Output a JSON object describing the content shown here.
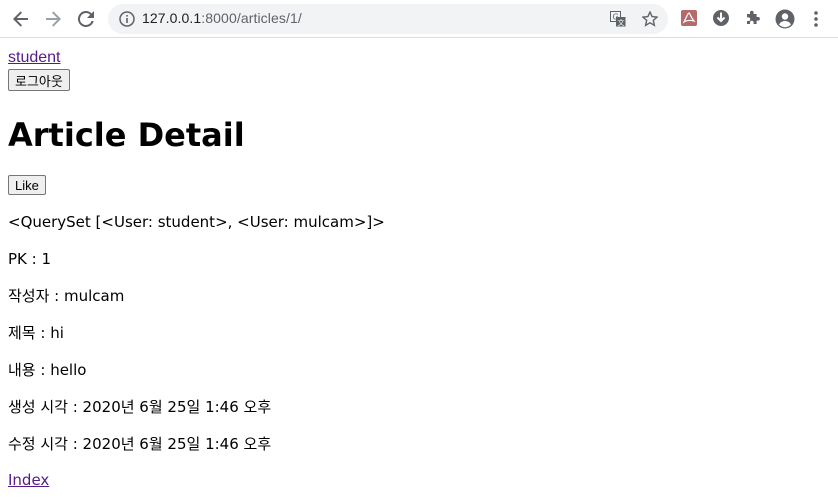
{
  "browser": {
    "url_host": "127.0.0.1",
    "url_path": ":8000/articles/1/"
  },
  "header": {
    "user_link": "student",
    "logout_label": "로그아웃"
  },
  "article": {
    "title": "Article Detail",
    "like_label": "Like",
    "queryset": "<QuerySet [<User: student>, <User: mulcam>]>",
    "pk": "PK : 1",
    "author": "작성자 : mulcam",
    "subject": "제목 : hi",
    "content": "내용 : hello",
    "created": "생성 시각 : 2020년 6월 25일 1:46 오후",
    "updated": "수정 시각 : 2020년 6월 25일 1:46 오후",
    "index_link": "Index"
  },
  "colors": {
    "link": "#551a8b",
    "toolbar_icon": "#5f6368",
    "omnibox_bg": "#f1f3f4"
  }
}
